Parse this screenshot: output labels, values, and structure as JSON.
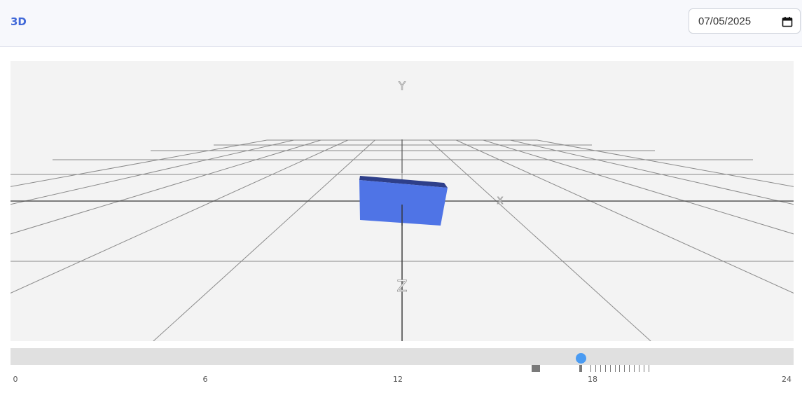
{
  "header": {
    "title": "3D",
    "date_value": "07/05/2025"
  },
  "viewport": {
    "axis_labels": {
      "y": "Y",
      "x": "X",
      "z": "Z"
    },
    "colors": {
      "background": "#f3f3f3",
      "grid": "#808080",
      "box_front": "#4f74e6",
      "box_top": "#2e3f8a"
    }
  },
  "timeline": {
    "labels": [
      "0",
      "6",
      "12",
      "18",
      "24"
    ],
    "range": [
      0,
      24
    ],
    "current_position": 17.6,
    "marker_block_position": 16.2,
    "tick_marks": [
      17.9,
      18.05,
      18.2,
      18.35,
      18.5,
      18.65,
      18.8,
      18.95,
      19.1,
      19.25,
      19.4,
      19.55,
      19.7
    ],
    "colors": {
      "track": "#e0e0e0",
      "handle": "#4a9bf2",
      "marker": "#7a7a7a"
    }
  }
}
